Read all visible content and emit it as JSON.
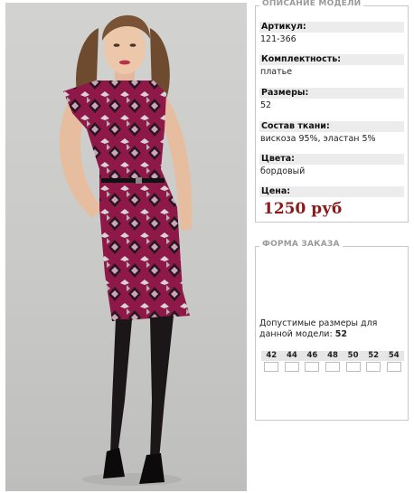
{
  "description": {
    "legend": "ОПИСАНИЕ МОДЕЛИ",
    "rows": [
      {
        "label": "Артикул:",
        "value": "121-366"
      },
      {
        "label": "Комплектность:",
        "value": "платье"
      },
      {
        "label": "Размеры:",
        "value": "52"
      },
      {
        "label": "Состав ткани:",
        "value": "вискоза 95%, эластан 5%"
      },
      {
        "label": "Цвета:",
        "value": "бордовый"
      }
    ],
    "price_label": "Цена:",
    "price_value": "1250 руб"
  },
  "order_form": {
    "legend": "ФОРМА ЗАКАЗА",
    "allowed_text": "Допустимые размеры для данной модели:",
    "allowed_value": "52",
    "sizes": [
      "42",
      "44",
      "46",
      "48",
      "50",
      "52",
      "54"
    ]
  },
  "colors": {
    "price": "#8b1a1a",
    "dress": "#8e1848"
  }
}
